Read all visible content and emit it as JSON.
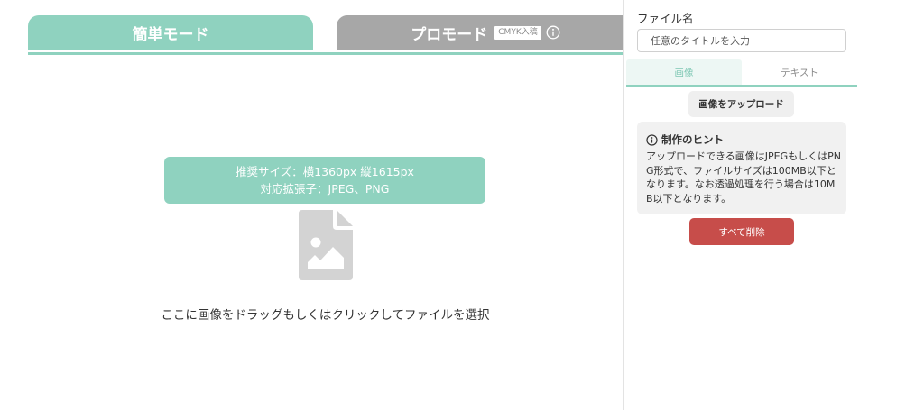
{
  "colors": {
    "accent": "#8fd2bf",
    "inactive_tab": "#a7a7a7",
    "danger": "#c74d4a",
    "hint_background": "#f1f1f1",
    "placeholder_icon": "#d3d3d3"
  },
  "left_pane": {
    "tabs": [
      {
        "label": "簡単モード",
        "active": true
      },
      {
        "label": "プロモード",
        "active": false,
        "badge": "CMYK入稿",
        "icon": "info-circle-icon"
      }
    ],
    "upload_area": {
      "recommended_size": "推奨サイズ：横1360px 縦1615px",
      "extensions": "対応拡張子：JPEG、PNG",
      "icon": "file-image-icon",
      "instruction": "ここに画像をドラッグもしくはクリックしてファイルを選択"
    }
  },
  "right_panel": {
    "filename_label": "ファイル名",
    "filename_input": {
      "value": "",
      "placeholder": "任意のタイトルを入力"
    },
    "tabs": [
      {
        "label": "画像",
        "active": true
      },
      {
        "label": "テキスト",
        "active": false
      }
    ],
    "upload_button": "画像をアップロード",
    "hint": {
      "icon": "info-circle-icon",
      "title": "制作のヒント",
      "text": "アップロードできる画像はJPEGもしくはPNG形式で、ファイルサイズは100MB以下となります。なお透過処理を行う場合は10MB以下となります。"
    },
    "delete_all_button": "すべて削除"
  }
}
